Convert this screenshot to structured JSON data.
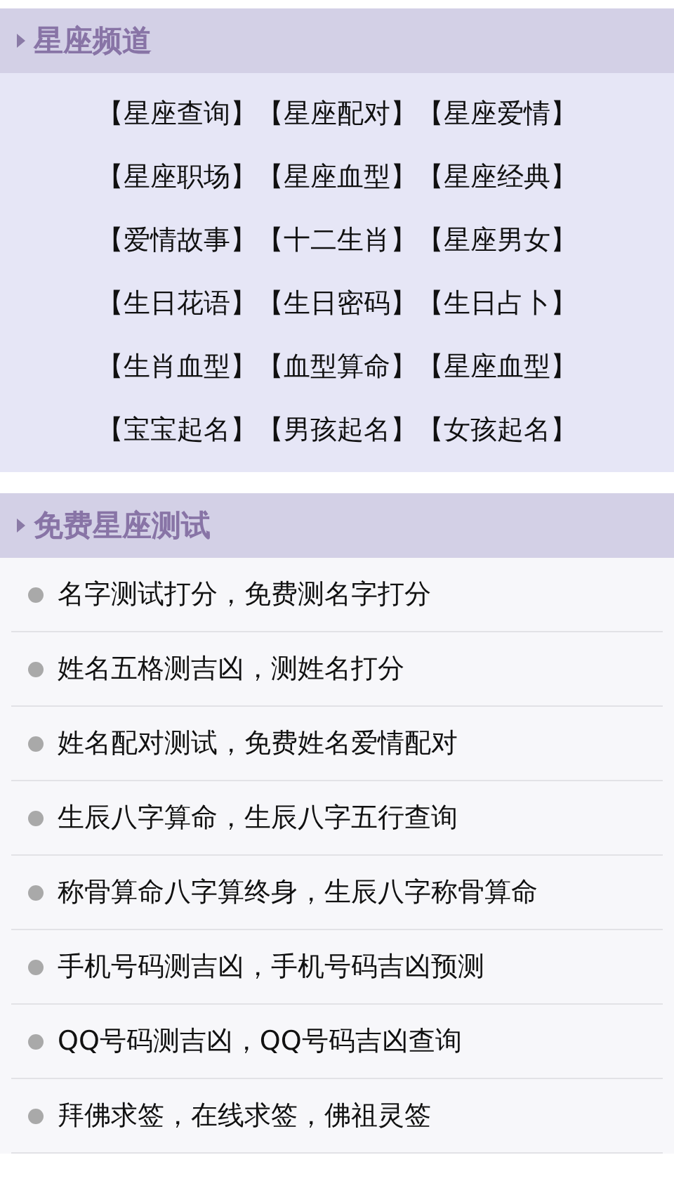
{
  "sections": [
    {
      "kind": "grid",
      "title": "星座频道",
      "links": [
        "【星座查询】",
        "【星座配对】",
        "【星座爱情】",
        "【星座职场】",
        "【星座血型】",
        "【星座经典】",
        "【爱情故事】",
        "【十二生肖】",
        "【星座男女】",
        "【生日花语】",
        "【生日密码】",
        "【生日占卜】",
        "【生肖血型】",
        "【血型算命】",
        "【星座血型】",
        "【宝宝起名】",
        "【男孩起名】",
        "【女孩起名】"
      ]
    },
    {
      "kind": "list",
      "title": "免费星座测试",
      "links": [
        "名字测试打分，免费测名字打分",
        "姓名五格测吉凶，测姓名打分",
        "姓名配对测试，免费姓名爱情配对",
        "生辰八字算命，生辰八字五行查询",
        "称骨算命八字算终身，生辰八字称骨算命",
        "手机号码测吉凶，手机号码吉凶预测",
        "QQ号码测吉凶，QQ号码吉凶查询",
        "拜佛求签，在线求签，佛祖灵签"
      ]
    }
  ]
}
